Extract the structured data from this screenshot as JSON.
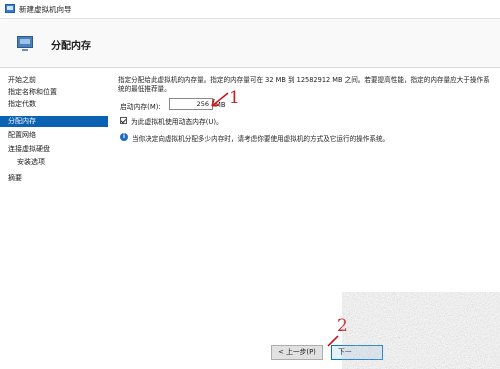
{
  "window": {
    "title": "新建虚拟机向导"
  },
  "header": {
    "title": "分配内存"
  },
  "sidebar": {
    "items": [
      {
        "label": "开始之前",
        "active": false
      },
      {
        "label": "指定名称和位置",
        "active": false
      },
      {
        "label": "指定代数",
        "active": false
      },
      {
        "label": "分配内存",
        "active": true
      },
      {
        "label": "配置网络",
        "active": false
      },
      {
        "label": "连接虚拟硬盘",
        "active": false
      },
      {
        "label": "安装选项",
        "active": false,
        "sub": true
      },
      {
        "label": "摘要",
        "active": false
      }
    ]
  },
  "main": {
    "description": "指定分配给此虚拟机的内存量。指定的内存量可在 32 MB 到 12582912 MB 之间。若要提高性能，指定的内存量应大于操作系统的最低推荐量。",
    "startup_memory": {
      "label": "启动内存(M):",
      "value": "256",
      "unit": "MB"
    },
    "dynamic_memory": {
      "label": "为此虚拟机使用动态内存(U)。",
      "checked": true
    },
    "info": "当你决定向虚拟机分配多少内存时，请考虑你要使用虚拟机的方式及它运行的操作系统。"
  },
  "footer": {
    "prev_label": "< 上一步(P)",
    "next_label": "下一"
  },
  "annotations": {
    "step1": "1",
    "step2": "2",
    "color": "#c81c1c"
  },
  "colors": {
    "accent": "#0b62b3",
    "info": "#1e6ac2"
  }
}
